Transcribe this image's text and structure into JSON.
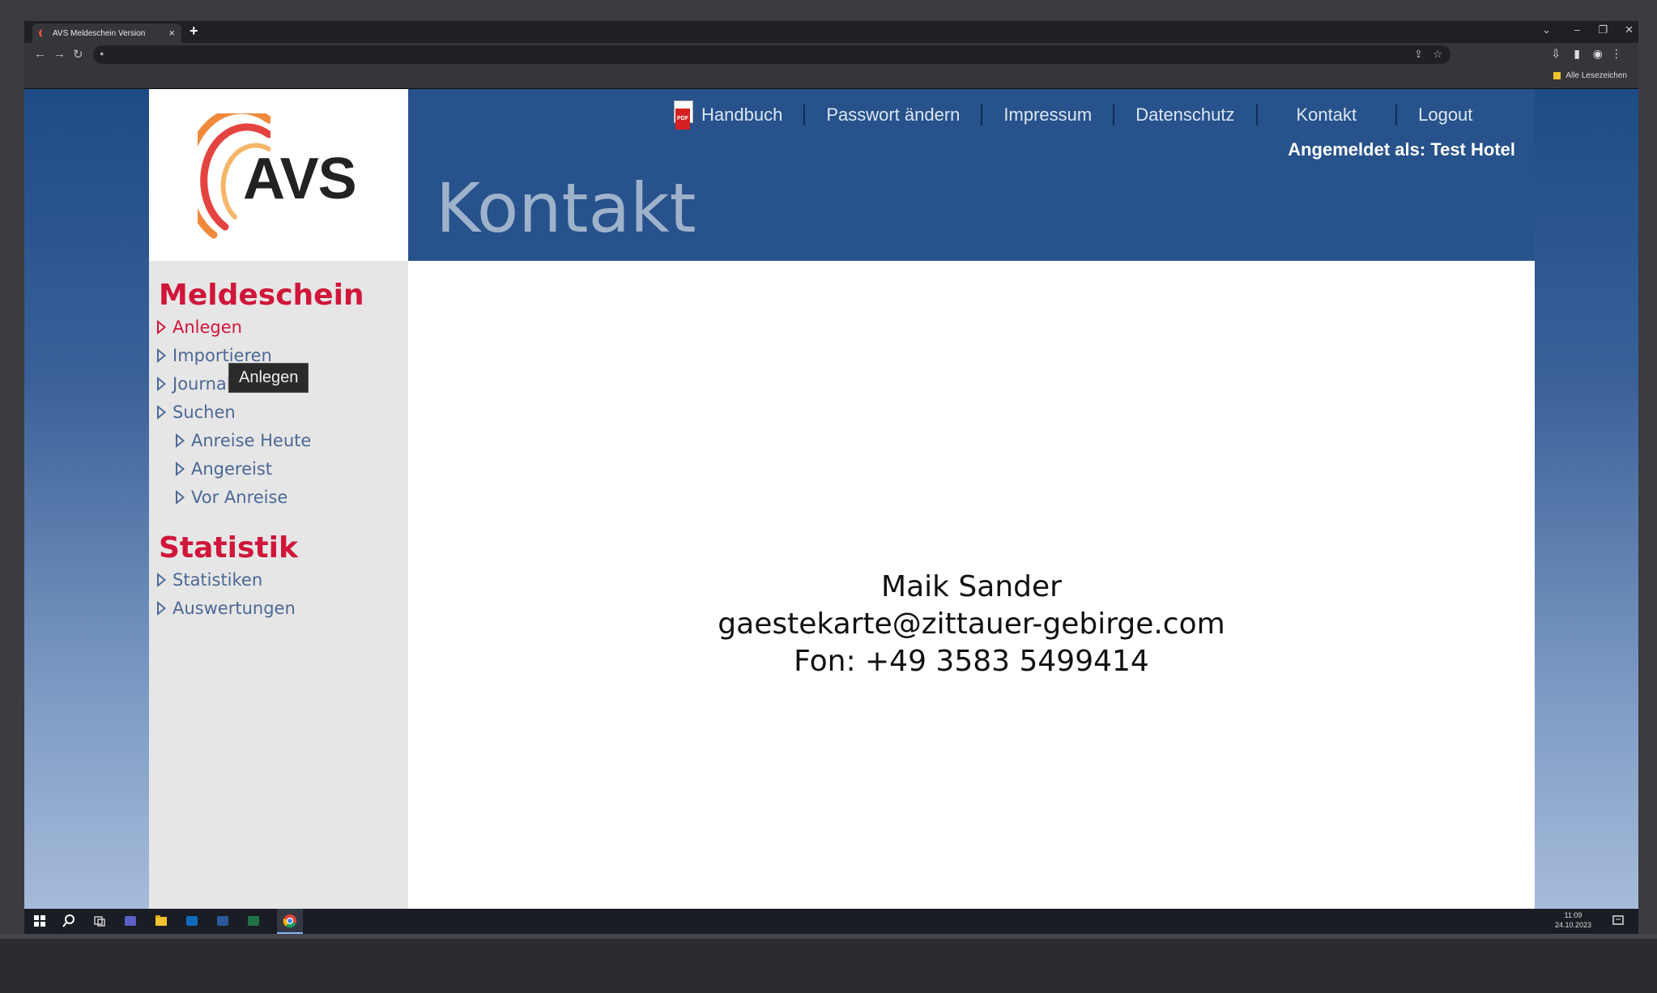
{
  "browser": {
    "tab_title": "AVS Meldeschein Version",
    "bookmarks_label": "Alle Lesezeichen"
  },
  "header": {
    "nav": [
      {
        "label": "Handbuch"
      },
      {
        "label": "Passwort ändern"
      },
      {
        "label": "Impressum"
      },
      {
        "label": "Datenschutz"
      },
      {
        "label": "Kontakt"
      },
      {
        "label": "Logout"
      }
    ],
    "pdf_icon_text": "PDF",
    "user_info": "Angemeldet als: Test Hotel",
    "page_title": "Kontakt"
  },
  "logo": {
    "text": "AVS"
  },
  "sidebar": {
    "section1_title": "Meldeschein",
    "section1_items": [
      {
        "label": "Anlegen"
      },
      {
        "label": "Importieren"
      },
      {
        "label": "Journal"
      },
      {
        "label": "Suchen"
      },
      {
        "label": "Anreise Heute"
      },
      {
        "label": "Angereist"
      },
      {
        "label": "Vor Anreise"
      }
    ],
    "section2_title": "Statistik",
    "section2_items": [
      {
        "label": "Statistiken"
      },
      {
        "label": "Auswertungen"
      }
    ],
    "tooltip": "Anlegen"
  },
  "content": {
    "name": "Maik Sander",
    "email": "gaestekarte@zittauer-gebirge.com",
    "phone": "Fon: +49 3583 5499414"
  },
  "taskbar": {
    "time": "11:09",
    "date": "24.10.2023"
  },
  "colors": {
    "header_blue": "#27528b",
    "accent_red": "#d0163a",
    "link_blue": "#4b6896"
  }
}
